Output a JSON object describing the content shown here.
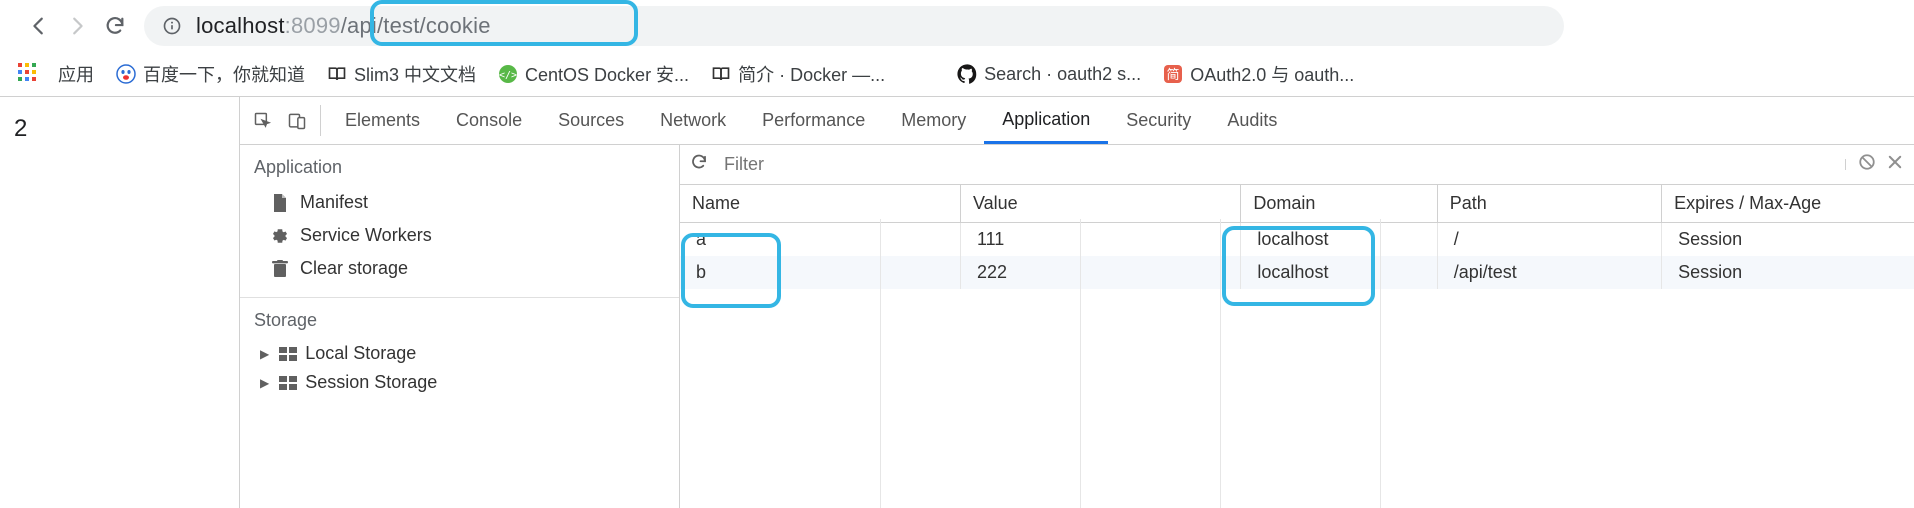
{
  "nav": {
    "url_host": "localhost",
    "url_port": ":8099",
    "url_path": "/api/test/cookie"
  },
  "bookmarks_bar": {
    "apps_label": "应用",
    "items": [
      {
        "label": "百度一下，你就知道",
        "icon": "baidu"
      },
      {
        "label": "Slim3 中文文档",
        "icon": "book"
      },
      {
        "label": "CentOS Docker 安...",
        "icon": "centos"
      },
      {
        "label": "简介 · Docker —...",
        "icon": "book"
      },
      {
        "label": "Search · oauth2 s...",
        "icon": "github"
      },
      {
        "label": "OAuth2.0 与 oauth...",
        "icon": "jian"
      }
    ]
  },
  "page_content": "2",
  "devtools": {
    "tabs": [
      "Elements",
      "Console",
      "Sources",
      "Network",
      "Performance",
      "Memory",
      "Application",
      "Security",
      "Audits"
    ],
    "active_tab": "Application",
    "sidebar": {
      "groups": [
        {
          "title": "Application",
          "items": [
            "Manifest",
            "Service Workers",
            "Clear storage"
          ]
        },
        {
          "title": "Storage",
          "items": [
            "Local Storage",
            "Session Storage"
          ]
        }
      ]
    },
    "cookies": {
      "filter_placeholder": "Filter",
      "columns": [
        "Name",
        "Value",
        "Domain",
        "Path",
        "Expires / Max-Age"
      ],
      "rows": [
        {
          "name": "a",
          "value": "111",
          "domain": "localhost",
          "path": "/",
          "expires": "Session"
        },
        {
          "name": "b",
          "value": "222",
          "domain": "localhost",
          "path": "/api/test",
          "expires": "Session"
        }
      ]
    }
  }
}
